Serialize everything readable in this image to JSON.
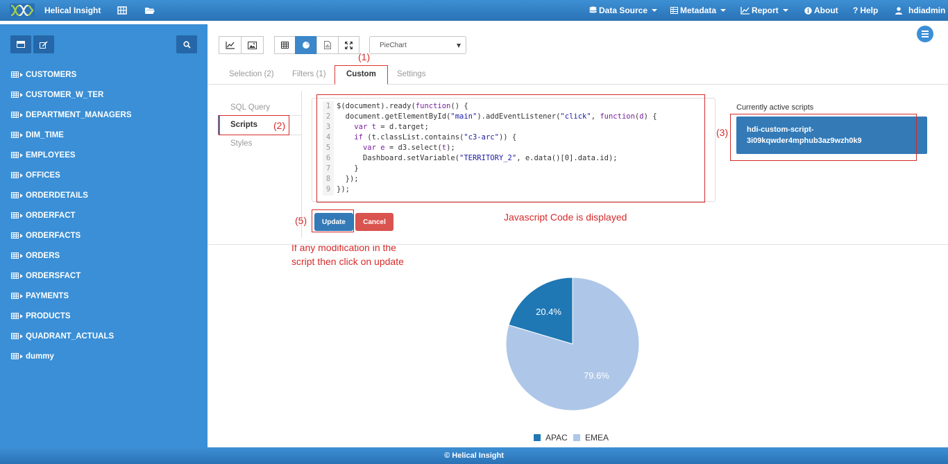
{
  "app": {
    "brand": "Helical Insight",
    "footer": "© Helical Insight"
  },
  "nav": {
    "data_source": "Data Source",
    "metadata": "Metadata",
    "report": "Report",
    "about": "About",
    "help": "Help",
    "user": "hdiadmin"
  },
  "sidebar": {
    "tables": [
      "CUSTOMERS",
      "CUSTOMER_W_TER",
      "DEPARTMENT_MANAGERS",
      "DIM_TIME",
      "EMPLOYEES",
      "OFFICES",
      "ORDERDETAILS",
      "ORDERFACT",
      "ORDERFACTS",
      "ORDERS",
      "ORDERSFACT",
      "PAYMENTS",
      "PRODUCTS",
      "QUADRANT_ACTUALS",
      "dummy"
    ]
  },
  "toolbar": {
    "chart_type": "PieChart"
  },
  "tabs": {
    "selection": "Selection (2)",
    "filters": "Filters (1)",
    "custom": "Custom",
    "settings": "Settings"
  },
  "subtabs": {
    "sql_query": "SQL Query",
    "scripts": "Scripts",
    "styles": "Styles"
  },
  "editor": {
    "line_numbers": [
      "1",
      "2",
      "3",
      "4",
      "5",
      "6",
      "7",
      "8",
      "9"
    ]
  },
  "scripts_panel": {
    "label": "Currently active scripts",
    "script_name_line1": "hdi-custom-script-",
    "script_name_line2": "3i09kqwder4mphub3az9wzh0k9"
  },
  "buttons": {
    "update": "Update",
    "cancel": "Cancel"
  },
  "annotations": {
    "a1": "(1)",
    "a2": "(2)",
    "a3": "(3)",
    "a5": "(5)",
    "code_note": "Javascript Code is displayed",
    "update_note_line1": "If any modification in the",
    "update_note_line2": "script then click on update"
  },
  "chart_data": {
    "type": "pie",
    "categories": [
      "APAC",
      "EMEA"
    ],
    "values": [
      20.4,
      79.6
    ],
    "data_labels": [
      "20.4%",
      "79.6%"
    ],
    "colors": [
      "#1f77b4",
      "#aec7e8"
    ],
    "legend_position": "bottom"
  }
}
